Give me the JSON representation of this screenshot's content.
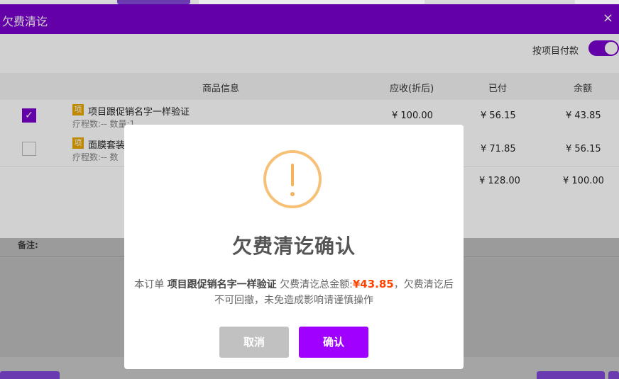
{
  "panel": {
    "title": "欠费清讫",
    "close": "×"
  },
  "toggle": {
    "label": "按项目付款",
    "on": true
  },
  "table": {
    "headers": [
      "商品信息",
      "应收(折后)",
      "已付",
      "余额"
    ],
    "rows": [
      {
        "checked": true,
        "tag": "项",
        "name": "项目跟促销名字一样验证",
        "sub": "疗程数:-- 数量:1",
        "receivable": "¥ 100.00",
        "paid": "¥ 56.15",
        "balance": "¥ 43.85"
      },
      {
        "checked": false,
        "tag": "项",
        "name": "面膜套装",
        "sub": "疗程数:-- 数",
        "receivable": "",
        "paid": "¥ 71.85",
        "balance": "¥ 56.15"
      }
    ],
    "totals": {
      "paid": "¥ 128.00",
      "balance": "¥ 100.00"
    }
  },
  "note_label": "备注:",
  "modal": {
    "title": "欠费清讫确认",
    "body_prefix": "本订单 ",
    "body_item": "项目跟促销名字一样验证",
    "body_mid": " 欠费清讫总金额:",
    "body_amount": "¥43.85",
    "body_suffix": "，欠费清讫后不可回撤，未免造成影响请谨慎操作",
    "cancel_label": "取消",
    "confirm_label": "确认",
    "warning_color": "#f6c177",
    "confirm_color": "#a000ff",
    "amount_color": "#ff4400"
  }
}
